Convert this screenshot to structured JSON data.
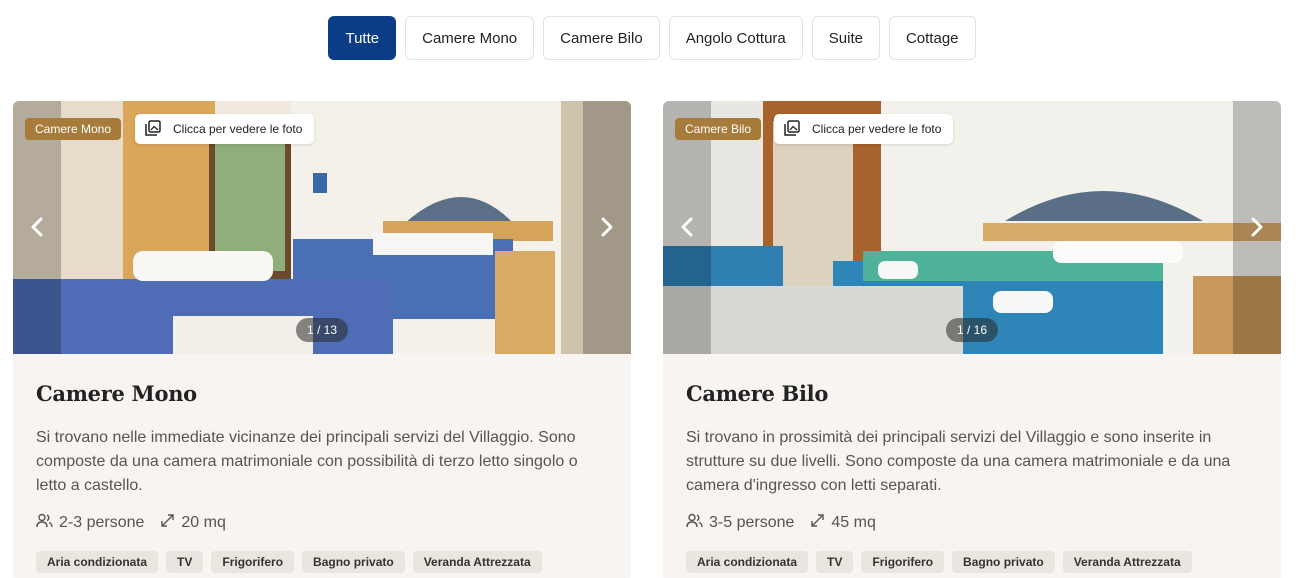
{
  "filters": [
    {
      "label": "Tutte",
      "active": true
    },
    {
      "label": "Camere Mono",
      "active": false
    },
    {
      "label": "Camere Bilo",
      "active": false
    },
    {
      "label": "Angolo Cottura",
      "active": false
    },
    {
      "label": "Suite",
      "active": false
    },
    {
      "label": "Cottage",
      "active": false
    }
  ],
  "photo_button_label": "Clicca per vedere le foto",
  "cards": [
    {
      "category_badge": "Camere Mono",
      "counter": "1 / 13",
      "title": "Camere Mono",
      "description": "Si trovano nelle immediate vicinanze dei principali servizi del Villaggio. Sono composte da una camera matrimoniale con possibilità di terzo letto singolo o letto a castello.",
      "guests": "2-3 persone",
      "size": "20 mq",
      "amenities": [
        "Aria condizionata",
        "TV",
        "Frigorifero",
        "Bagno privato",
        "Veranda Attrezzata"
      ]
    },
    {
      "category_badge": "Camere Bilo",
      "counter": "1 / 16",
      "title": "Camere Bilo",
      "description": "Si trovano in prossimità dei principali servizi del Villaggio e sono inserite in strutture su due livelli. Sono composte da una camera matrimoniale e da una camera d'ingresso con letti separati.",
      "guests": "3-5 persone",
      "size": "45 mq",
      "amenities": [
        "Aria condizionata",
        "TV",
        "Frigorifero",
        "Bagno privato",
        "Veranda Attrezzata"
      ]
    }
  ],
  "icons": {
    "prev": "chevron-left-icon",
    "next": "chevron-right-icon",
    "photos": "photo-gallery-icon",
    "guests": "users-icon",
    "size": "expand-icon"
  },
  "colors": {
    "active_filter": "#0b3d86",
    "badge": "#a77b3a",
    "card_bg": "#f7f4f1",
    "tag_bg": "#ebe5df"
  }
}
